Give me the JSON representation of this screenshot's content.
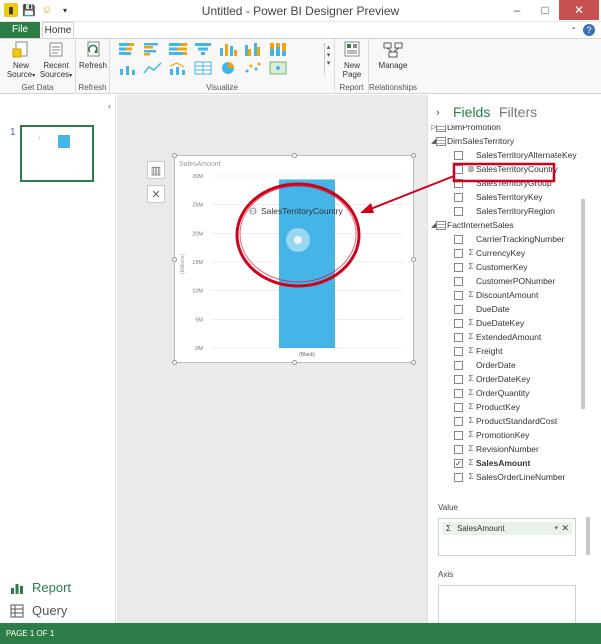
{
  "window": {
    "title": "Untitled - Power BI Designer Preview",
    "minimize": "–",
    "maximize": "□",
    "close": "✕"
  },
  "ribbon": {
    "tabs": {
      "file": "File",
      "home": "Home"
    },
    "groups": {
      "get_data": {
        "label": "Get Data",
        "new_source": "New\nSource",
        "recent_sources": "Recent\nSources"
      },
      "refresh": {
        "label": "Refresh",
        "button": "Refresh"
      },
      "visualize": {
        "label": "Visualize"
      },
      "report": {
        "label": "Report",
        "new_page": "New\nPage"
      },
      "relationships": {
        "label": "Relationships",
        "manage": "Manage"
      }
    },
    "help": "?"
  },
  "left_pane": {
    "page_number": "1",
    "nav": {
      "report": "Report",
      "query": "Query"
    }
  },
  "visual": {
    "hover_label": "SalesTerritoryCountry",
    "accent": "#45B5E8"
  },
  "chart_data": {
    "type": "bar",
    "title": "SalesAmount",
    "categories": [
      "(Blank)"
    ],
    "values": [
      29.4
    ],
    "ylabel": "(Millions)",
    "ylim": [
      0,
      30
    ],
    "yticks": [
      "0M",
      "5M",
      "10M",
      "15M",
      "20M",
      "25M",
      "30M"
    ],
    "grid": true,
    "color": "#45B5E8"
  },
  "fields_pane": {
    "tabs": {
      "fields": "Fields",
      "filters": "Filters"
    },
    "rows": [
      {
        "kind": "table",
        "label": "DimPromotion",
        "expanded": false
      },
      {
        "kind": "table",
        "label": "DimSalesTerritory",
        "expanded": true
      },
      {
        "kind": "field",
        "icon": "",
        "label": "SalesTerritoryAlternateKey",
        "checked": false
      },
      {
        "kind": "field",
        "icon": "globe",
        "label": "SalesTerritoryCountry",
        "checked": false,
        "highlight": true
      },
      {
        "kind": "field",
        "icon": "",
        "label": "SalesTerritoryGroup",
        "checked": false
      },
      {
        "kind": "field",
        "icon": "",
        "label": "SalesTerritoryKey",
        "checked": false
      },
      {
        "kind": "field",
        "icon": "",
        "label": "SalesTerritoryRegion",
        "checked": false
      },
      {
        "kind": "table",
        "label": "FactInternetSales",
        "expanded": true
      },
      {
        "kind": "field",
        "icon": "",
        "label": "CarrierTrackingNumber",
        "checked": false
      },
      {
        "kind": "field",
        "icon": "sigma",
        "label": "CurrencyKey",
        "checked": false
      },
      {
        "kind": "field",
        "icon": "sigma",
        "label": "CustomerKey",
        "checked": false
      },
      {
        "kind": "field",
        "icon": "",
        "label": "CustomerPONumber",
        "checked": false
      },
      {
        "kind": "field",
        "icon": "sigma",
        "label": "DiscountAmount",
        "checked": false
      },
      {
        "kind": "field",
        "icon": "",
        "label": "DueDate",
        "checked": false
      },
      {
        "kind": "field",
        "icon": "sigma",
        "label": "DueDateKey",
        "checked": false
      },
      {
        "kind": "field",
        "icon": "sigma",
        "label": "ExtendedAmount",
        "checked": false
      },
      {
        "kind": "field",
        "icon": "sigma",
        "label": "Freight",
        "checked": false
      },
      {
        "kind": "field",
        "icon": "",
        "label": "OrderDate",
        "checked": false
      },
      {
        "kind": "field",
        "icon": "sigma",
        "label": "OrderDateKey",
        "checked": false
      },
      {
        "kind": "field",
        "icon": "sigma",
        "label": "OrderQuantity",
        "checked": false
      },
      {
        "kind": "field",
        "icon": "sigma",
        "label": "ProductKey",
        "checked": false
      },
      {
        "kind": "field",
        "icon": "sigma",
        "label": "ProductStandardCost",
        "checked": false
      },
      {
        "kind": "field",
        "icon": "sigma",
        "label": "PromotionKey",
        "checked": false
      },
      {
        "kind": "field",
        "icon": "sigma",
        "label": "RevisionNumber",
        "checked": false
      },
      {
        "kind": "field",
        "icon": "sigma",
        "label": "SalesAmount",
        "checked": true,
        "bold": true
      },
      {
        "kind": "field",
        "icon": "sigma",
        "label": "SalesOrderLineNumber",
        "checked": false
      }
    ],
    "value_section": {
      "label": "Value",
      "pill": "SalesAmount"
    },
    "axis_section": {
      "label": "Axis"
    }
  },
  "status": {
    "text": "PAGE 1 OF 1"
  },
  "annotation_color": "#D0021B"
}
